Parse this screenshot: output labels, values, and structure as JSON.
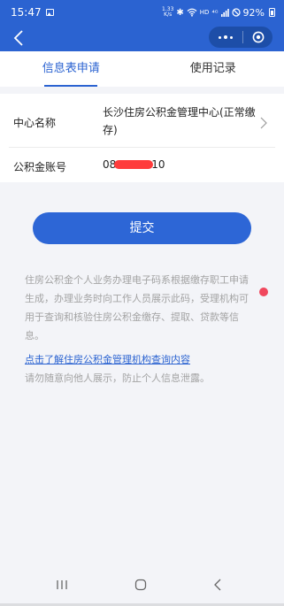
{
  "status_bar": {
    "time": "15:47",
    "speed_value": "1.33",
    "speed_unit": "K/s",
    "bluetooth_glyph": "✱",
    "hd": "HD",
    "signal": "⁴ᴳ",
    "battery": "92%",
    "icons": [
      "image-notification-icon",
      "bluetooth-icon",
      "wifi-icon",
      "signal-icon",
      "dnd-icon",
      "battery-icon"
    ]
  },
  "nav": {
    "back_icon": "chevron-left-icon",
    "capsule_icons": [
      "more-icon",
      "close-circle-icon"
    ]
  },
  "tabs": [
    {
      "label": "信息表申请",
      "active": true
    },
    {
      "label": "使用记录",
      "active": false
    }
  ],
  "form": {
    "center_label": "中心名称",
    "center_value_line1": "长沙住房公积金管理中心(正常缴",
    "center_value_line2": "存)",
    "account_label": "公积金账号",
    "account_prefix": "08",
    "account_suffix": "10"
  },
  "submit_label": "提交",
  "notice": {
    "text": "住房公积金个人业务办理电子码系根据缴存职工申请生成，办理业务时向工作人员展示此码，受理机构可用于查询和核验住房公积金缴存、提取、贷款等信息。",
    "link": "点击了解住房公积金管理机构查询内容",
    "warning": "请勿随意向他人展示，防止个人信息泄露。"
  },
  "system_nav": {
    "icons": [
      "recent-apps-icon",
      "home-icon",
      "back-icon"
    ]
  },
  "colors": {
    "primary": "#2b63d1",
    "button": "#2d66d6",
    "notice_text": "#a3a3a3",
    "redaction": "#ff3b3b",
    "dot": "#f0475d"
  }
}
